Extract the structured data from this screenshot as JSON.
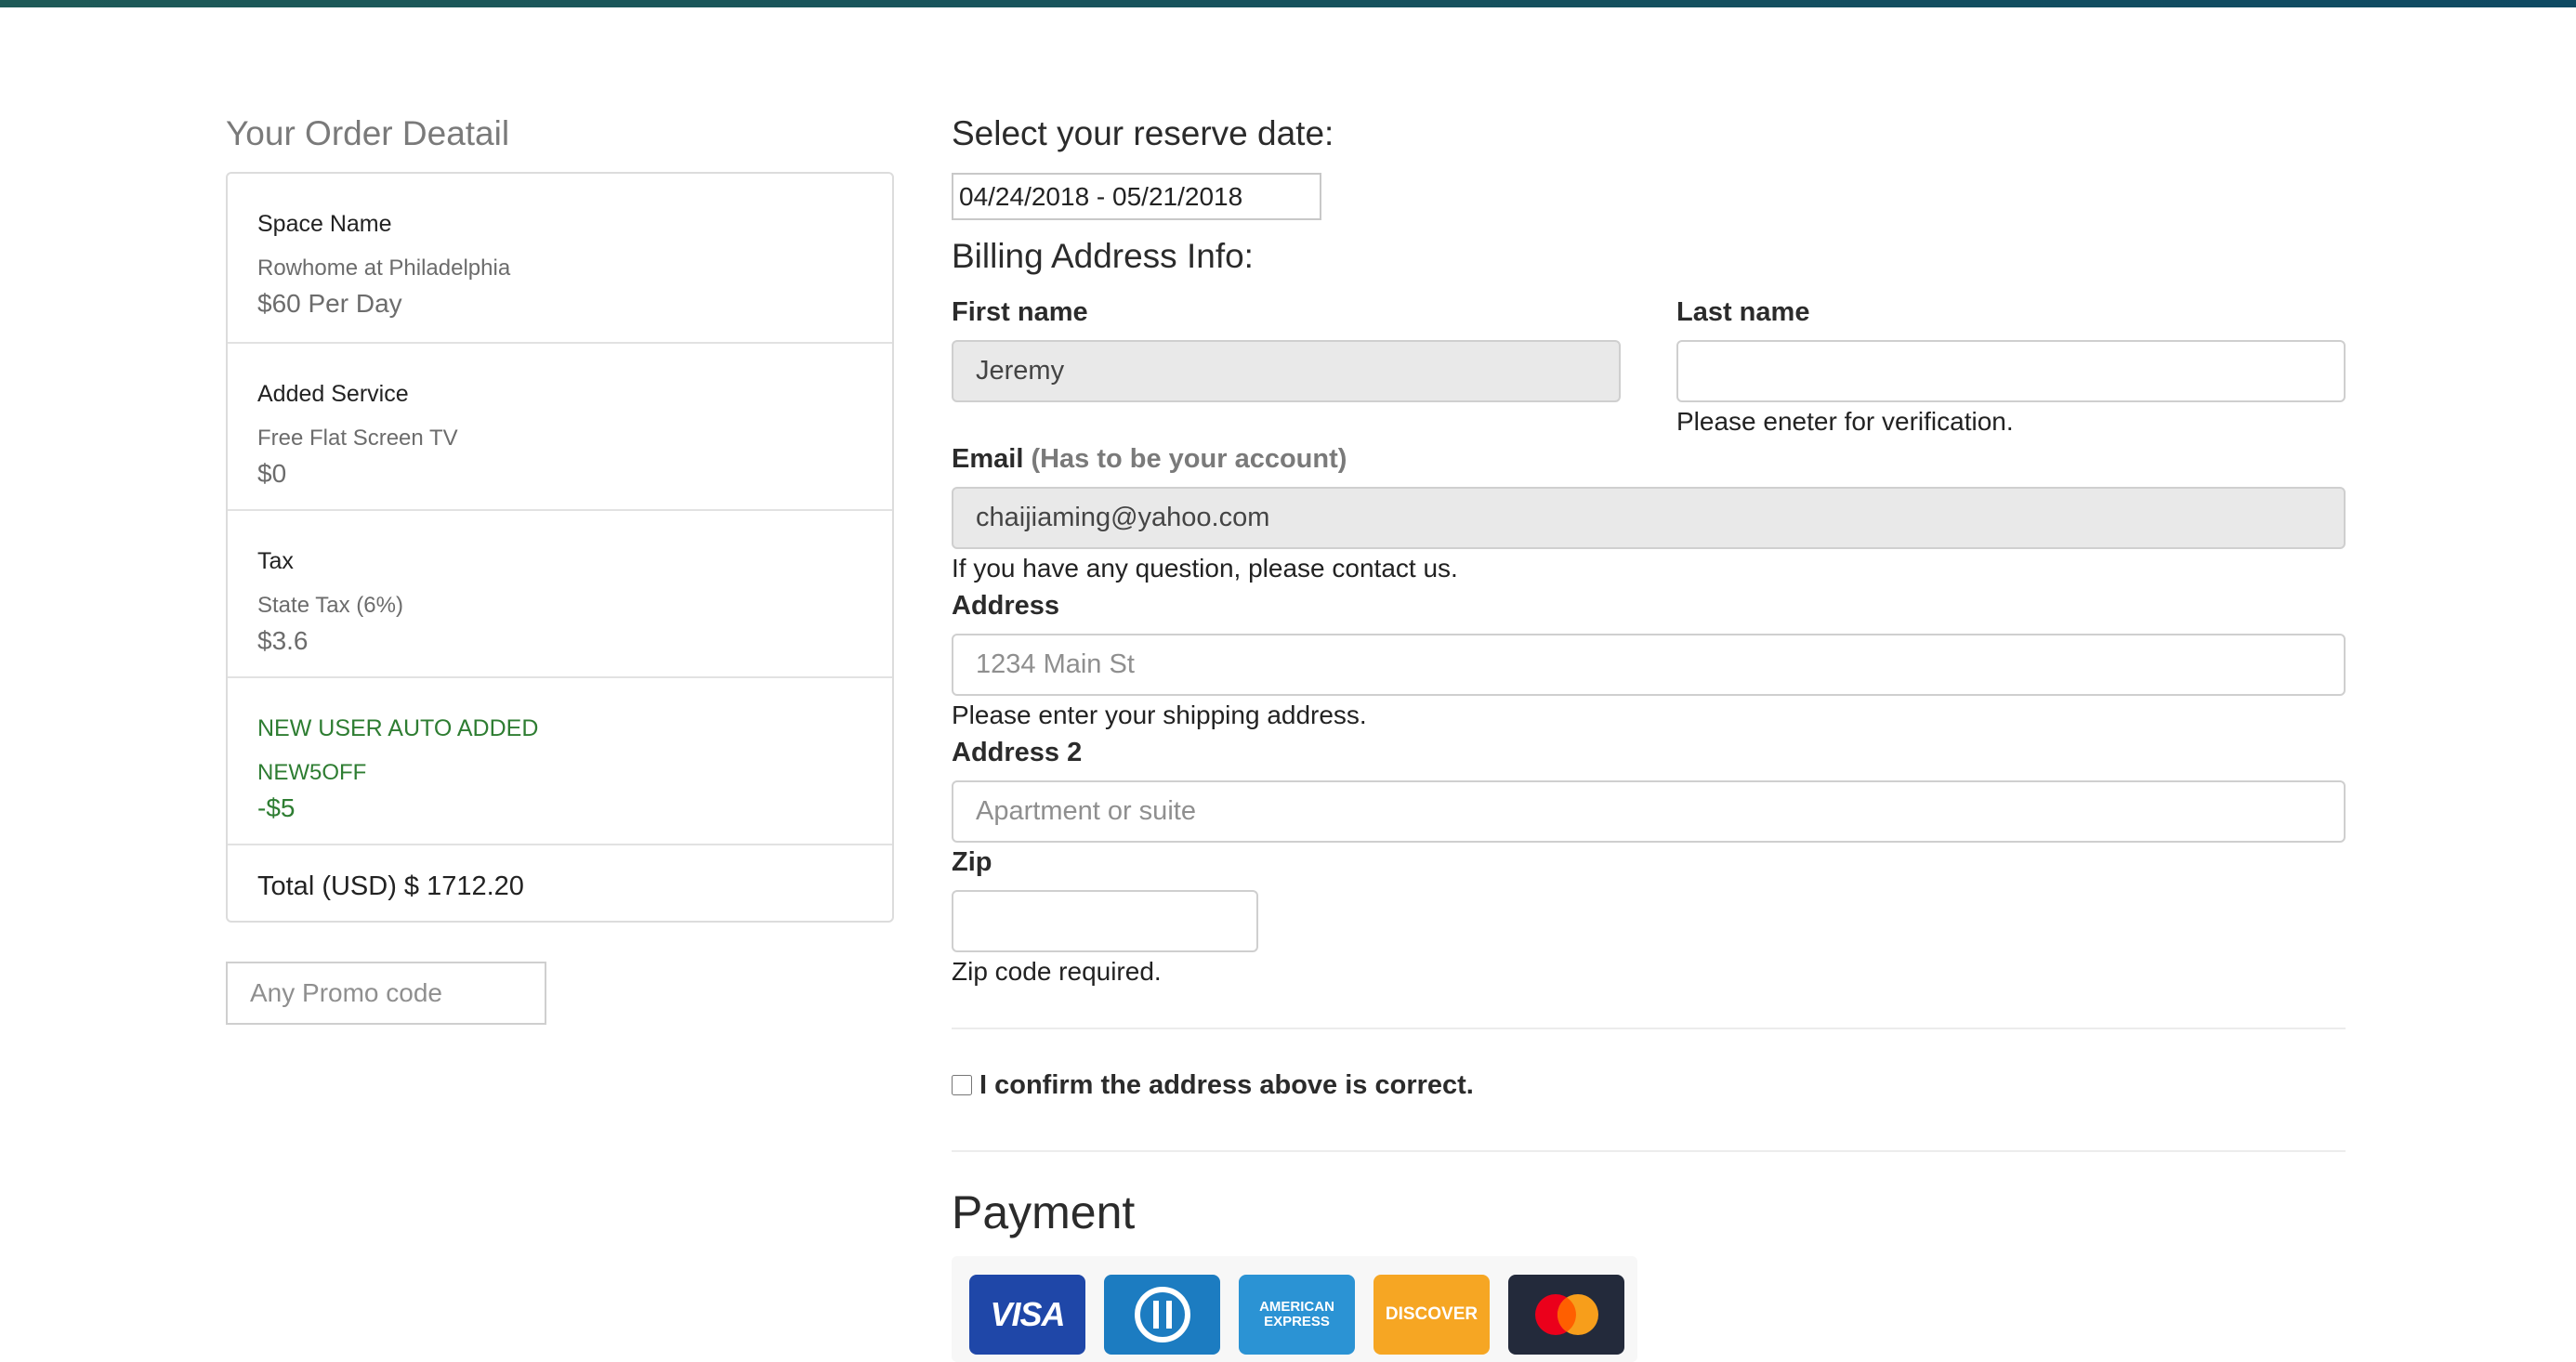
{
  "colors": {
    "top_bar_start": "#1e5a57",
    "top_bar_end": "#0f4a63",
    "promo_green": "#2e7d32",
    "visa": "#1f47a8",
    "diners": "#1c7cc1",
    "amex": "#2b93d4",
    "discover": "#f6a623",
    "mastercard_bg": "#232a3b"
  },
  "order": {
    "title": "Your Order Deatail",
    "items": [
      {
        "title": "Space Name",
        "subtitle": "Rowhome at Philadelphia",
        "price": "$60 Per Day"
      },
      {
        "title": "Added Service",
        "subtitle": "Free Flat Screen TV",
        "price": "$0"
      },
      {
        "title": "Tax",
        "subtitle": "State Tax (6%)",
        "price": "$3.6"
      },
      {
        "title": "NEW USER AUTO ADDED",
        "subtitle": "NEW5OFF",
        "price": "-$5"
      }
    ],
    "total_label": "Total (USD)",
    "total_value": "$ 1712.20"
  },
  "promo": {
    "placeholder": "Any Promo code"
  },
  "reserve": {
    "heading": "Select your reserve date:",
    "date_range": "04/24/2018 - 05/21/2018"
  },
  "billing": {
    "heading": "Billing Address Info:",
    "first_name": {
      "label": "First name",
      "value": "Jeremy"
    },
    "last_name": {
      "label": "Last name",
      "value": "",
      "help": "Please eneter for verification."
    },
    "email": {
      "label": "Email",
      "note": "(Has to be your account)",
      "value": "chaijiaming@yahoo.com",
      "help": "If you have any question, please contact us."
    },
    "address": {
      "label": "Address",
      "placeholder": "1234 Main St",
      "help": "Please enter your shipping address."
    },
    "address2": {
      "label": "Address 2",
      "placeholder": "Apartment or suite"
    },
    "zip": {
      "label": "Zip",
      "value": "",
      "help": "Zip code required."
    },
    "confirm_label": "I confirm the address above is correct."
  },
  "payment": {
    "heading": "Payment",
    "cards": [
      {
        "name": "VISA",
        "icon": "visa-icon"
      },
      {
        "name": "Diners Club",
        "icon": "diners-club-icon"
      },
      {
        "name": "AMERICAN EXPRESS",
        "icon": "amex-icon"
      },
      {
        "name": "DISCOVER",
        "icon": "discover-icon"
      },
      {
        "name": "Mastercard",
        "icon": "mastercard-icon"
      }
    ]
  }
}
